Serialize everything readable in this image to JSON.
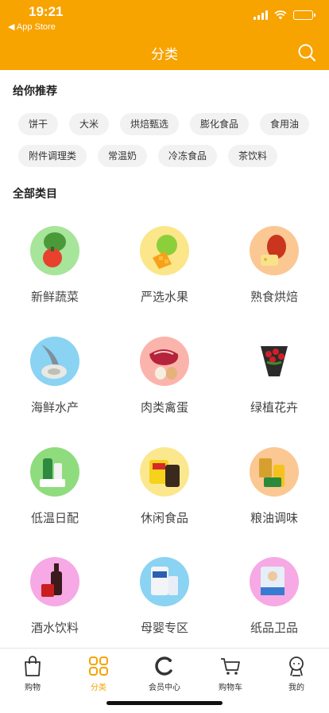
{
  "status_bar": {
    "time": "19:21",
    "back_app": "◀ App Store"
  },
  "header": {
    "title": "分类"
  },
  "recommend": {
    "title": "给你推荐",
    "tags": [
      "饼干",
      "大米",
      "烘焙甄选",
      "膨化食品",
      "食用油",
      "附件调理类",
      "常温奶",
      "冷冻食品",
      "茶饮料"
    ]
  },
  "all_categories": {
    "title": "全部类目",
    "items": [
      "新鲜蔬菜",
      "严选水果",
      "熟食烘焙",
      "海鲜水产",
      "肉类禽蛋",
      "绿植花卉",
      "低温日配",
      "休闲食品",
      "粮油调味",
      "酒水饮料",
      "母婴专区",
      "纸品卫品"
    ]
  },
  "tab_bar": {
    "tabs": [
      {
        "label": "购物",
        "icon": "shopping-bag-icon"
      },
      {
        "label": "分类",
        "icon": "grid-icon"
      },
      {
        "label": "会员中心",
        "icon": "member-icon"
      },
      {
        "label": "购物车",
        "icon": "cart-icon"
      },
      {
        "label": "我的",
        "icon": "user-icon"
      }
    ],
    "active_index": 1
  },
  "colors": {
    "accent": "#f7a300"
  }
}
